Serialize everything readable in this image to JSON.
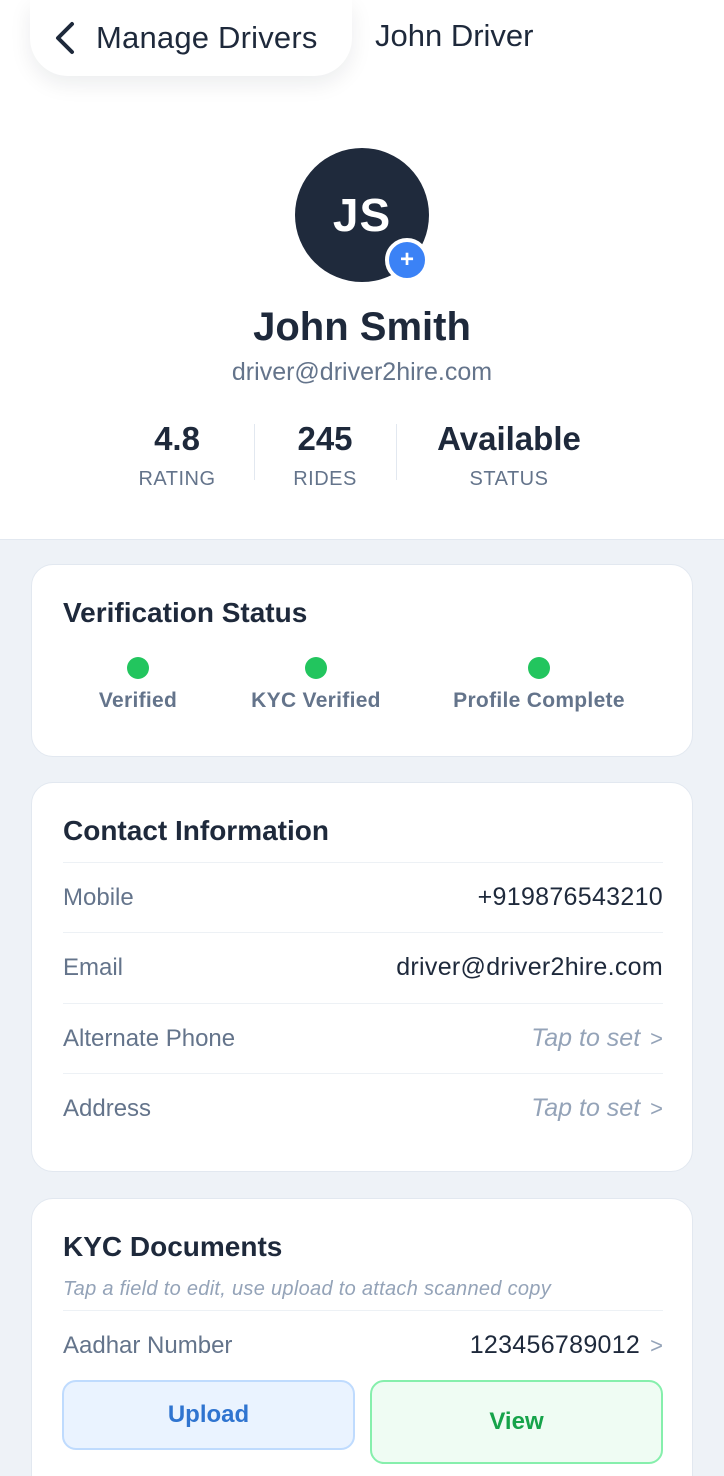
{
  "header": {
    "back_label": "Manage Drivers",
    "title": "John Driver"
  },
  "profile": {
    "initials": "JS",
    "add_symbol": "+",
    "name": "John Smith",
    "email": "driver@driver2hire.com",
    "stats": [
      {
        "value": "4.8",
        "label": "RATING"
      },
      {
        "value": "245",
        "label": "RIDES"
      },
      {
        "value": "Available",
        "label": "STATUS"
      }
    ]
  },
  "verification": {
    "title": "Verification Status",
    "items": [
      {
        "label": "Verified",
        "color": "#22c55e"
      },
      {
        "label": "KYC Verified",
        "color": "#22c55e"
      },
      {
        "label": "Profile Complete",
        "color": "#22c55e"
      }
    ]
  },
  "contact": {
    "title": "Contact Information",
    "rows": [
      {
        "label": "Mobile",
        "value": "+919876543210"
      },
      {
        "label": "Email",
        "value": "driver@driver2hire.com"
      },
      {
        "label": "Alternate Phone",
        "value": "Tap to set",
        "chevron": ">"
      },
      {
        "label": "Address",
        "value": "Tap to set",
        "chevron": ">"
      }
    ]
  },
  "kyc": {
    "title": "KYC Documents",
    "hint": "Tap a field to edit, use upload to attach scanned copy",
    "rows": [
      {
        "label": "Aadhar Number",
        "value": "123456789012",
        "chevron": ">"
      }
    ],
    "upload_label": "Upload",
    "view_label": "View"
  },
  "colors": {
    "accent": "#3b82f6",
    "success": "#22c55e",
    "avatar_bg": "#1f2a3c"
  }
}
